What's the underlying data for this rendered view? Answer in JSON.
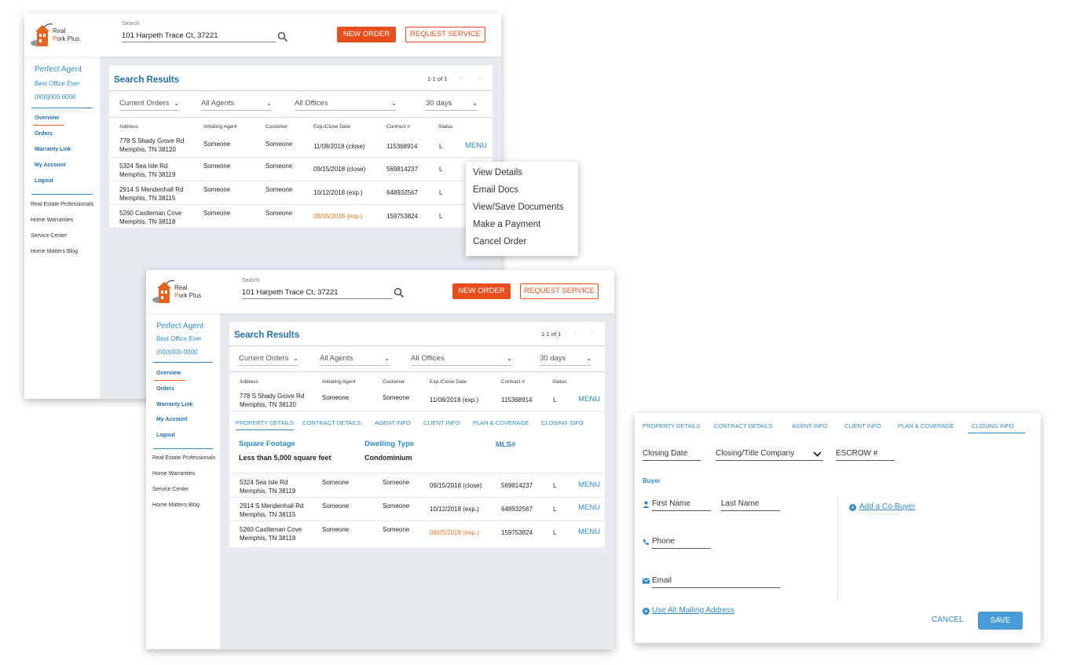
{
  "brand": {
    "line1": "Real",
    "line2_a": "P",
    "line2_b": "ork Plus"
  },
  "header": {
    "search_label": "Search",
    "search_value": "101 Harpeth Trace Ct, 37221",
    "new_order": "NEW ORDER",
    "request_service": "REQUEST SERVICE"
  },
  "agent": {
    "name": "Perfect Agent",
    "office": "Best Office Ever",
    "phone": "(000)000-0000"
  },
  "nav": [
    "Overview",
    "Orders",
    "Warranty Link",
    "My Account",
    "Logout"
  ],
  "external_links": [
    "Real Estate Professionals",
    "Home Warranties",
    "Service Center",
    "Home Matters Blog"
  ],
  "results": {
    "title": "Search Results",
    "pager": "1-1 of 1",
    "filters": [
      "Current Orders",
      "All Agents",
      "All Offices",
      "30 days"
    ],
    "columns": [
      "Address",
      "Initiating Agent",
      "Customer",
      "Exp./Close Date",
      "Contract #",
      "Status"
    ],
    "menu_label": "MENU",
    "rows": [
      {
        "addr1": "778 S Shady Grove Rd",
        "addr2": "Memphis, TN 38120",
        "agent": "Someone",
        "customer": "Someone",
        "date": "11/08/2018 (close)",
        "contract": "115368914",
        "status": "L"
      },
      {
        "addr1": "5324 Sea Isle Rd",
        "addr2": "Memphis, TN 38119",
        "agent": "Someone",
        "customer": "Someone",
        "date": "09/15/2018 (close)",
        "contract": "569814237",
        "status": "L"
      },
      {
        "addr1": "2914 S Mendenhall Rd",
        "addr2": "Memphis, TN 38115",
        "agent": "Someone",
        "customer": "Someone",
        "date": "10/12/2018 (exp.)",
        "contract": "648932567",
        "status": "L"
      },
      {
        "addr1": "5260 Castleman Cove",
        "addr2": "Memphis, TN 38118",
        "agent": "Someone",
        "customer": "Someone",
        "date": "08/05/2018 (exp.)",
        "contract": "159753824",
        "status": "L"
      }
    ],
    "row1_date_exp": "11/08/2018 (exp.)"
  },
  "context_menu": [
    "View Details",
    "Email Docs",
    "View/Save Documents",
    "Make a Payment",
    "Cancel Order"
  ],
  "detail_tabs": [
    "PROPERTY DETAILS",
    "CONTRACT DETAILS",
    "AGENT INFO",
    "CLIENT INFO",
    "PLAN & COVERAGE",
    "CLOSING INFO"
  ],
  "property_details": {
    "sq_label": "Square Footage",
    "sq_value": "Less than 5,000 square feet",
    "dwelling_label": "Dwelling Type",
    "dwelling_value": "Condominium",
    "mls_label": "MLS#"
  },
  "closing": {
    "closing_date": "Closing Date",
    "title_company": "Closing/Title Company",
    "escrow": "ESCROW #",
    "buyer_heading": "Buyer",
    "first_name": "First Name",
    "last_name": "Last Name",
    "phone": "Phone",
    "email": "Email",
    "add_cobuyer": "Add a Co-Buyer",
    "alt_mailing": "Use Alt Mailing Address",
    "cancel": "CANCEL",
    "save": "SAVE"
  },
  "colors": {
    "accent_orange": "#e84e1b",
    "link_blue": "#2f8bc9",
    "overdue_orange": "#e87722"
  }
}
